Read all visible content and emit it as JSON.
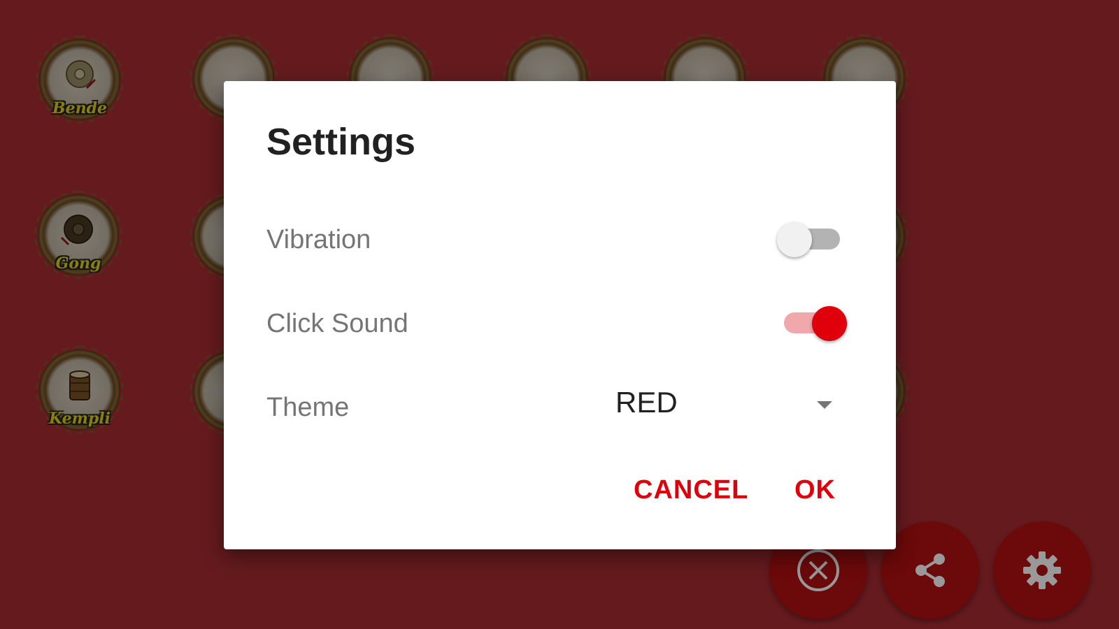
{
  "instruments": [
    {
      "name": "Bende"
    },
    {
      "name": "Gong"
    },
    {
      "name": "Kempli"
    }
  ],
  "colors": {
    "theme_red": "#e0000b",
    "background": "#a92d32",
    "fab": "#b40f12"
  },
  "fab_buttons": [
    {
      "icon": "close-circle-icon"
    },
    {
      "icon": "share-icon"
    },
    {
      "icon": "gear-icon"
    }
  ],
  "dialog": {
    "title": "Settings",
    "vibration": {
      "label": "Vibration",
      "enabled": false
    },
    "click_sound": {
      "label": "Click Sound",
      "enabled": true
    },
    "theme": {
      "label": "Theme",
      "value": "RED"
    },
    "buttons": {
      "cancel": "CANCEL",
      "ok": "OK"
    }
  }
}
